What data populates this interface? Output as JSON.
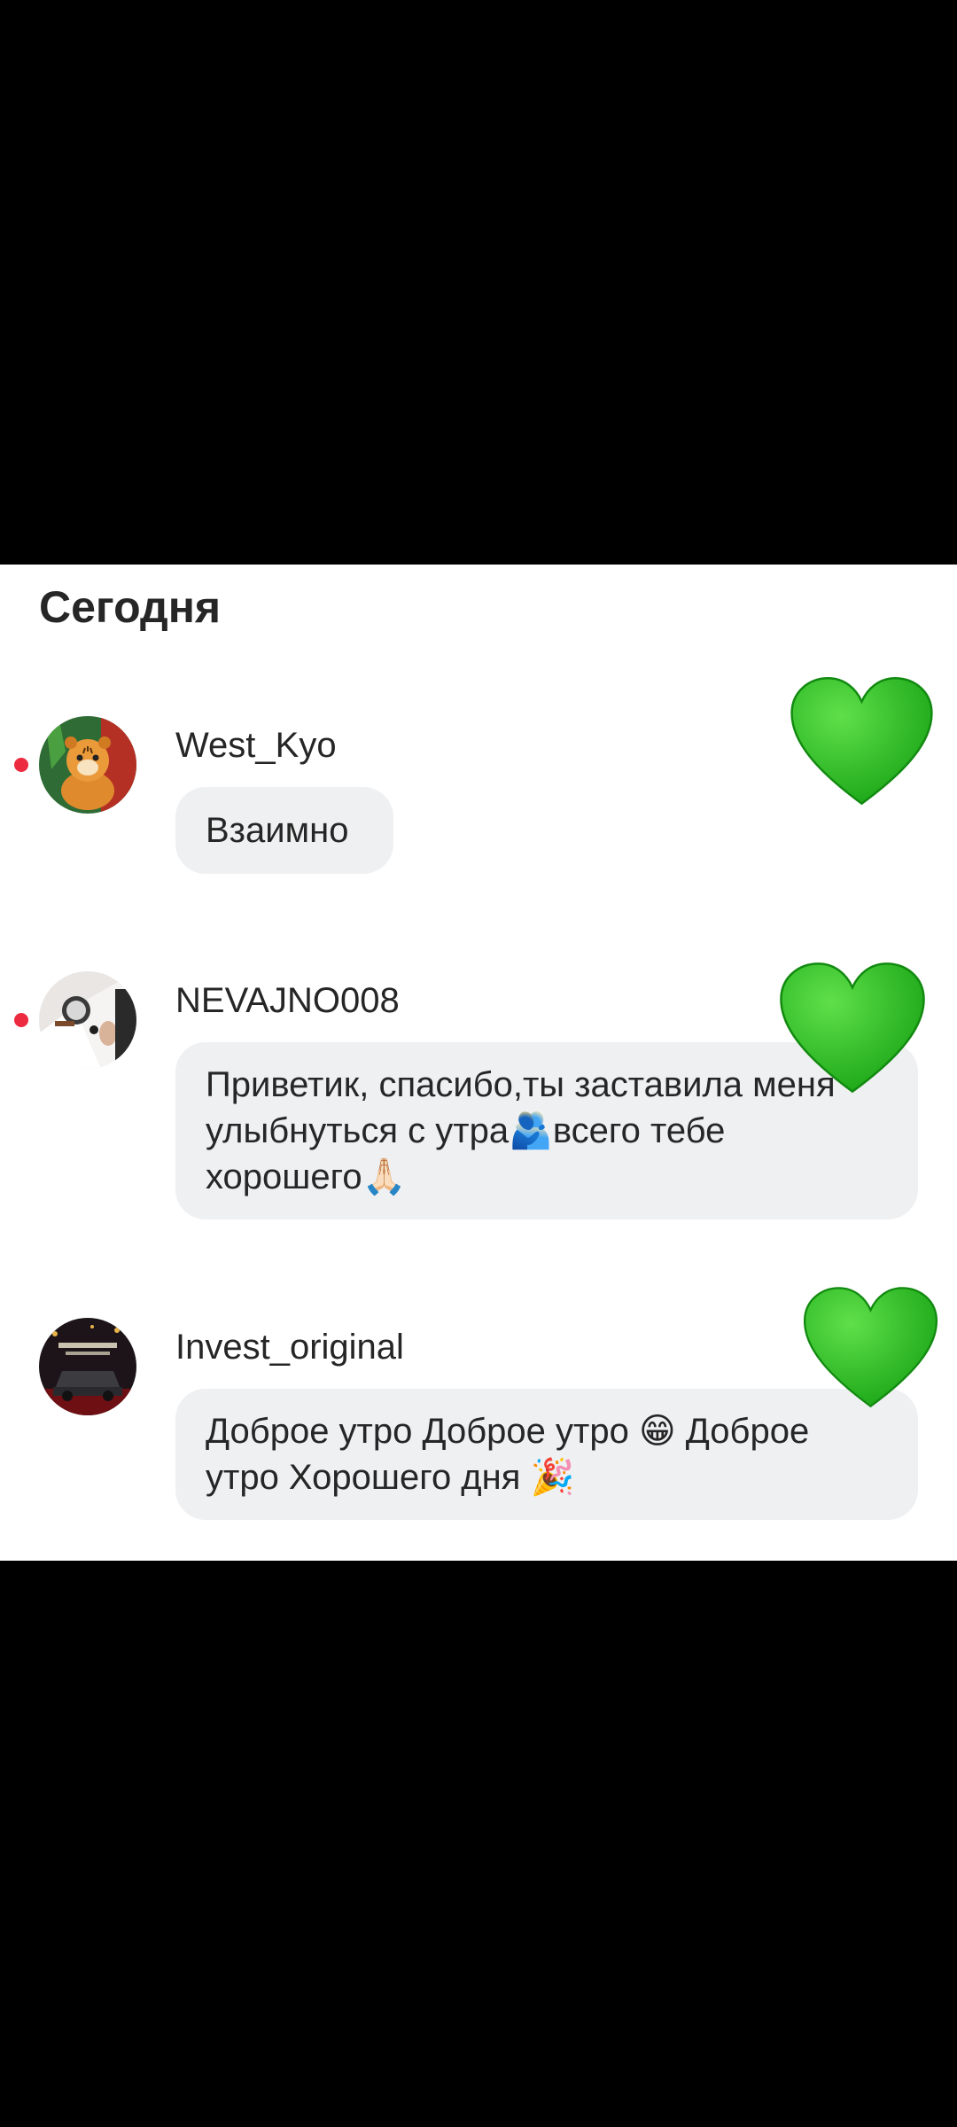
{
  "section_title": "Сегодня",
  "reaction_icon": "green-heart",
  "colors": {
    "unread_dot": "#ed2b40",
    "bubble_bg": "#eff0f2",
    "heart": "#22b41e",
    "text": "#262626"
  },
  "messages": [
    {
      "username": "West_Kyo",
      "text": "Взаимно",
      "unread": true,
      "avatar_icon": "tiger-cub-avatar"
    },
    {
      "username": "NEVAJNO008",
      "text": "Приветик, спасибо,ты заставила меня улыбнуться с утра🫂всего тебе хорошего🙏🏻",
      "unread": true,
      "avatar_icon": "watch-cufflink-avatar"
    },
    {
      "username": "Invest_original",
      "text": "Доброе утро  Доброе утро 😁 Доброе утро  Хорошего дня 🎉",
      "unread": false,
      "avatar_icon": "dark-car-avatar"
    }
  ]
}
